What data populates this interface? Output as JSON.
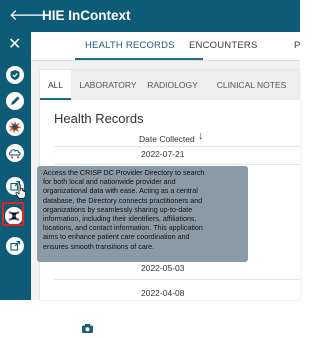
{
  "header": {
    "title": "HIE InContext",
    "back_icon": "arrow-left-icon"
  },
  "sidebar": {
    "close_label": "✕",
    "icons": [
      "shield-icon",
      "pencil-icon",
      "star-burst-icon",
      "cloud-network-icon",
      "external-link-icon",
      "crisp-directory-icon",
      "external-link-icon"
    ]
  },
  "top_tabs": [
    {
      "label": "HEALTH RECORDS",
      "active": true
    },
    {
      "label": "ENCOUNTERS",
      "active": false
    },
    {
      "label": "P",
      "active": false
    }
  ],
  "sub_tabs": [
    {
      "label": "ALL",
      "active": true
    },
    {
      "label": "LABORATORY",
      "active": false
    },
    {
      "label": "RADIOLOGY",
      "active": false
    },
    {
      "label": "CLINICAL NOTES",
      "active": false
    }
  ],
  "health_records": {
    "title": "Health Records",
    "column_header": "Date Collected",
    "sort_icon": "↓",
    "dates": [
      "2022-07-21",
      "2022-05-03",
      "2022-04-08"
    ]
  },
  "tooltip": {
    "lines": [
      "Access the CRISP DC Provider Directory to search",
      "for both local and nationwide provider and",
      "organizational data with ease. Acting as a central",
      "database, the Directory connects practitioners and",
      "organizations by seamlessly sharing up-to-date",
      "information, including their identifiers, affiliations,",
      "locations, and contact information. This application",
      "aims to enhance patient care coordination and",
      "ensures smooth transitions of care."
    ]
  },
  "colors": {
    "brand": "#0e5b77",
    "highlight": "#e0261b",
    "tooltip_bg": "#8a9aa6"
  }
}
